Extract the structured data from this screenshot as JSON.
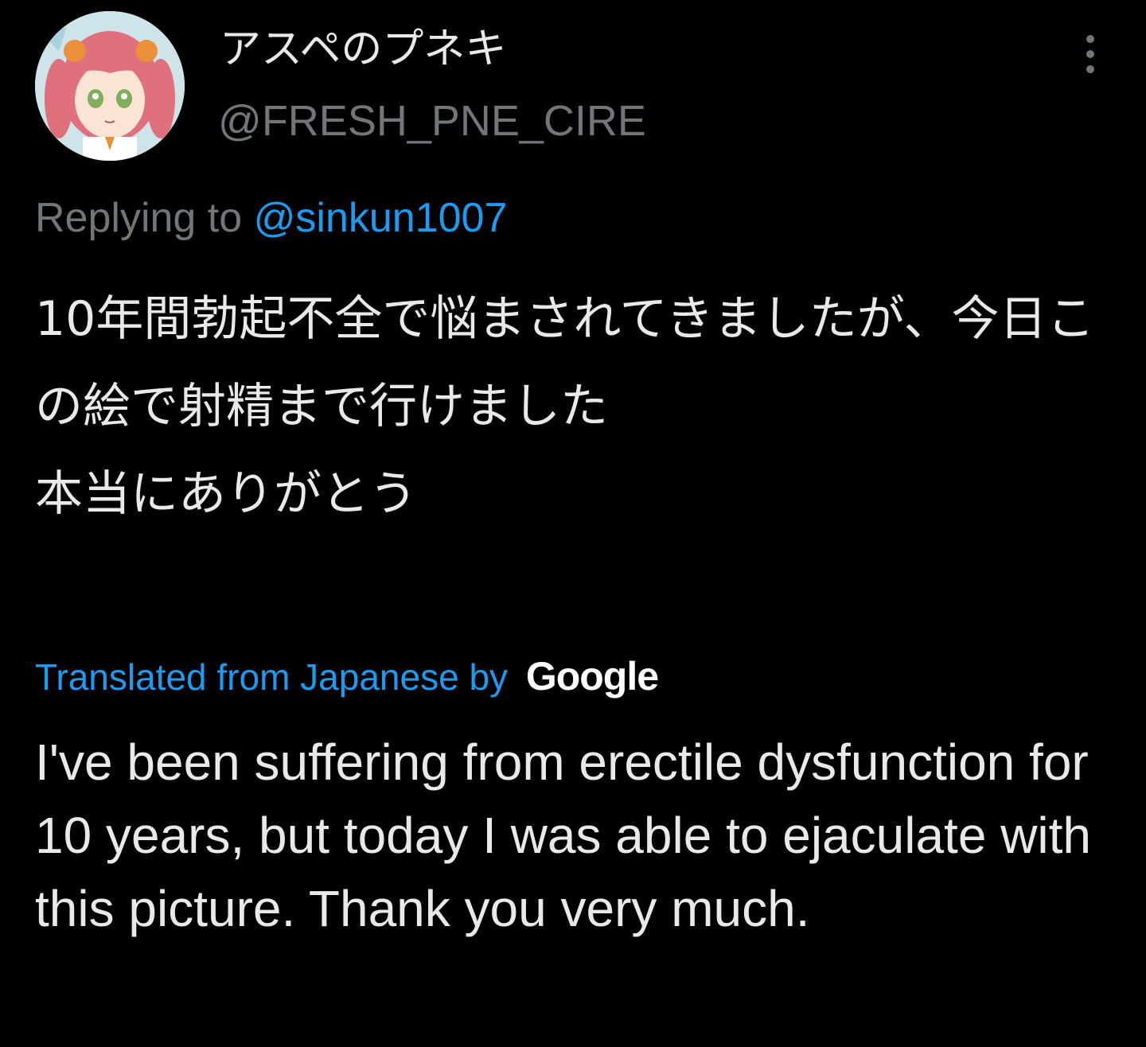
{
  "colors": {
    "background": "#000000",
    "primary_text": "#e7e9ea",
    "secondary_text": "#71767b",
    "accent": "#1d9bf0"
  },
  "author": {
    "display_name": "アスペのプネキ",
    "handle": "@FRESH_PNE_CIRE",
    "avatar_icon": "avatar-anime-girl"
  },
  "more_icon": "more-vertical-icon",
  "reply": {
    "prefix": "Replying to",
    "mention": "@sinkun1007"
  },
  "tweet": {
    "text": "10年間勃起不全で悩まされてきましたが、今日この絵で射精まで行けました\n本当にありがとう"
  },
  "translation": {
    "label": "Translated from Japanese by",
    "provider": "Google",
    "text": "I've been suffering from erectile dysfunction for 10 years, but today I was able to ejaculate with this picture. Thank you very much."
  }
}
